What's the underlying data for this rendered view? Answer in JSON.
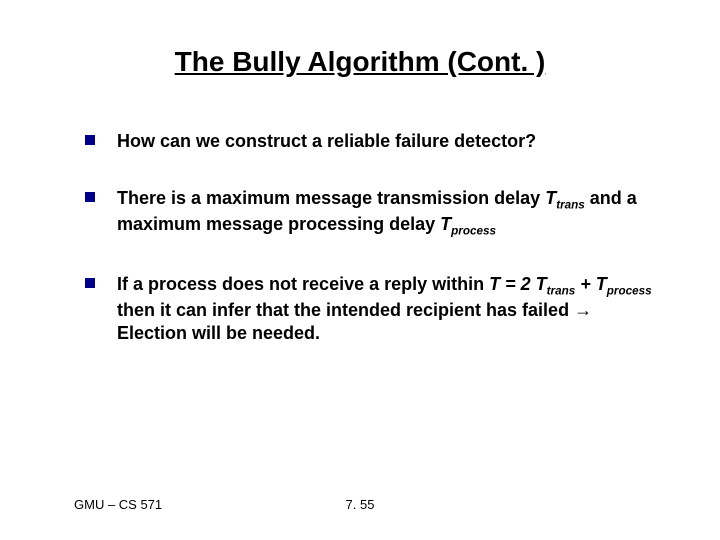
{
  "title": "The Bully Algorithm (Cont. )",
  "bullets": {
    "b1": "How can we construct a reliable failure detector?",
    "b2_a": "There is a maximum message transmission delay ",
    "b2_b": "T",
    "b2_c": "trans",
    "b2_d": "  and a maximum message processing delay ",
    "b2_e": "T",
    "b2_f": "process",
    "b3_a": "If a process does not receive a reply within ",
    "b3_b": "T = 2 T",
    "b3_c": "trans",
    "b3_d": "  + T",
    "b3_e": "process",
    "b3_f": "    then it can infer that the intended recipient has failed ",
    "b3_arrow": "→",
    "b3_g": " Election will be needed."
  },
  "footer": {
    "left": "GMU – CS 571",
    "center": "7. 55"
  }
}
